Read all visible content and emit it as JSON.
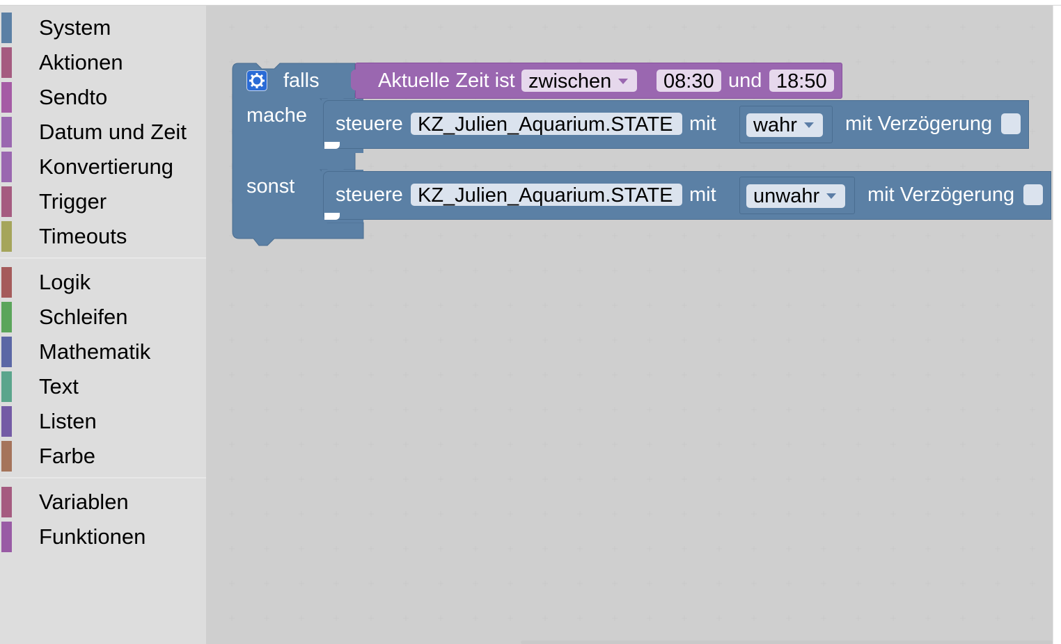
{
  "toolbox": {
    "groups": [
      [
        {
          "label": "System",
          "color": "#5b80a5"
        },
        {
          "label": "Aktionen",
          "color": "#a55b80"
        },
        {
          "label": "Sendto",
          "color": "#a55ba5"
        },
        {
          "label": "Datum und Zeit",
          "color": "#9a67b0"
        },
        {
          "label": "Konvertierung",
          "color": "#9a67b0"
        },
        {
          "label": "Trigger",
          "color": "#a55b80"
        },
        {
          "label": "Timeouts",
          "color": "#a5a55b"
        }
      ],
      [
        {
          "label": "Logik",
          "color": "#a55b5b"
        },
        {
          "label": "Schleifen",
          "color": "#5ba55b"
        },
        {
          "label": "Mathematik",
          "color": "#5b67a5"
        },
        {
          "label": "Text",
          "color": "#5ba58c"
        },
        {
          "label": "Listen",
          "color": "#745ba5"
        },
        {
          "label": "Farbe",
          "color": "#a5745b"
        }
      ],
      [
        {
          "label": "Variablen",
          "color": "#a55b80"
        },
        {
          "label": "Funktionen",
          "color": "#995ba5"
        }
      ]
    ]
  },
  "colors": {
    "if_block": "#5b80a5",
    "time_block": "#9a67b0",
    "control_block": "#5b80a5",
    "field_light": "#dbe3ee",
    "time_field": "#e6d8ec"
  },
  "if_block": {
    "if_label": "falls",
    "do_label": "mache",
    "else_label": "sonst"
  },
  "time_block": {
    "prefix": "Aktuelle Zeit ist",
    "operator": "zwischen",
    "start_time": "08:30",
    "and_label": "und",
    "end_time": "18:50"
  },
  "control_true": {
    "label": "steuere",
    "object_id": "KZ_Julien_Aquarium.STATE",
    "with_label": "mit",
    "value": "wahr",
    "delay_label": "mit Verzögerung"
  },
  "control_false": {
    "label": "steuere",
    "object_id": "KZ_Julien_Aquarium.STATE",
    "with_label": "mit",
    "value": "unwahr",
    "delay_label": "mit Verzögerung"
  }
}
